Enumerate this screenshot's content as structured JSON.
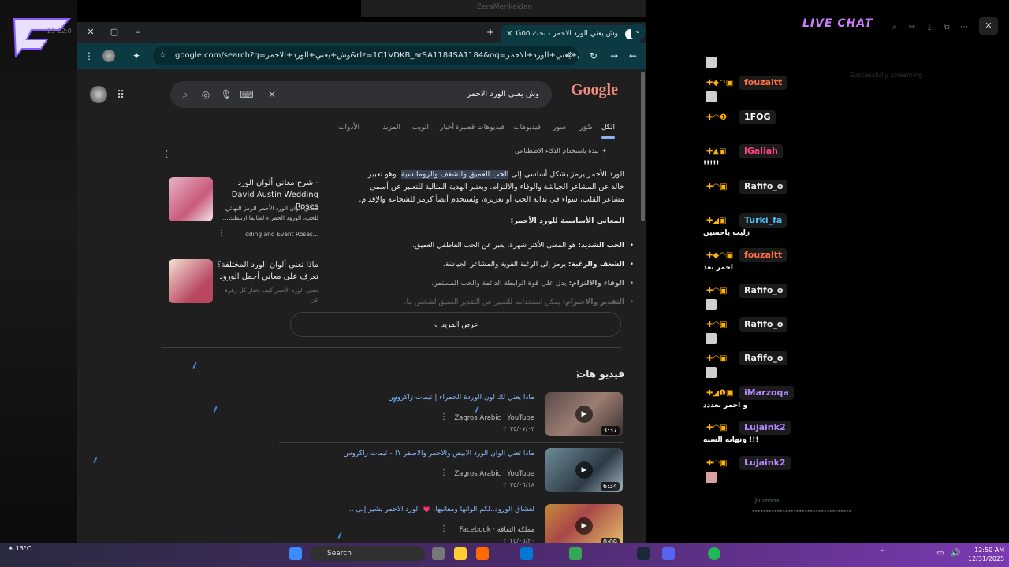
{
  "background": {
    "window_title": "ZeraMerikaidan",
    "clock_ghost": "25 22:0"
  },
  "browser": {
    "tab_title": "وش يعني الورد الاحمر - بحث Goo",
    "url": "google.com/search?q=وش+يعني+الورد+الاحمر&rlz=1C1VDKB_arSA1184SA1184&oq=وش+يعني+الورد+الاحمر&gs_lcrp...",
    "new_tab": "+",
    "icons": {
      "star": "star-icon",
      "tune": "tune-icon",
      "extensions": "puzzle-icon",
      "menu": "kebab-icon",
      "reload": "reload-icon",
      "back": "back-icon",
      "forward": "forward-icon"
    }
  },
  "google": {
    "logo": "Google",
    "query": "وش يعني الورد الاحمر",
    "tabs": [
      "الكل",
      "صُوَر",
      "سور",
      "فيديوهات",
      "فيديوهات قصيرة",
      "أخبار",
      "الويب",
      "المزيد",
      "الأدوات"
    ],
    "aio_label": "نبذة باستخدام الذكاء الاصطناعي",
    "aio_text_pre": "الورد الأحمر يرمز بشكل أساسي إلى ",
    "aio_text_hl": "الحب العميق والشغف والرومانسية",
    "aio_text_post": "، وهو تعبير خالد عن المشاعر الجياشة والوفاء والالتزام. ويعتبر الهدية المثالية للتعبير عن أسمى مشاعر القلب، سواء في بداية الحب أو تعزيزه، ويُستخدم أيضاً كرمز للشجاعة والإقدام.",
    "aio_heading": "المعاني الأساسية للورد الأحمر:",
    "bullets": [
      {
        "b": "الحب الشديد:",
        "t": " هو المعنى الأكثر شهرة، يعبر عن الحب العاطفي العميق."
      },
      {
        "b": "الشغف والرغبة:",
        "t": " يرمز إلى الرغبة القوية والمشاعر الجياشة."
      },
      {
        "b": "الوفاء والالتزام:",
        "t": " يدل على قوة الرابطة الدائمة والحب المستمر."
      },
      {
        "b": "التقدير والاحترام:",
        "t": " يمكن استخدامه للتعبير عن التقدير العميق لشخص ما."
      }
    ],
    "cards": [
      {
        "title": "شرح معاني ألوان الورد - David Austin Wedding Roses",
        "sub": "معاني ألوان الورد الأحمر الرمز النهائي للحب، الورود الحمراء لطالما ارتبطت...",
        "src": "dding and Event Roses..."
      },
      {
        "title": "ماذا تعني ألوان الورد المختلفة؟ تعرف على معاني أجمل الورود",
        "sub": "معنى الورد الأحمر كيف تختار كل زهرة عن",
        "src": ""
      }
    ],
    "show_more": "عرض المزيد",
    "videos_heading": "فيديو هات",
    "videos": [
      {
        "title": "ماذا يعني لك لون الوردة الحمراء | ثيمات زاكروس",
        "src": "Zagros Arabic · YouTube",
        "date": "٢٠٢٥/٠٧/٠٣",
        "dur": "3:37"
      },
      {
        "title": "ماذا تعني ألوان الورد الابيض والاحمر والاصفر ؟! - ثيمات زاكروس",
        "src": "Zagros Arabic · YouTube",
        "date": "٢٠٢٥/٠٦/١٨",
        "dur": "6:34"
      },
      {
        "title": "لعشاق الورود..لكم ألوانها ومعانيها. 💗 الورد الأحمر يشير إلى ...",
        "src": "Facebook · مملكة الثقافة",
        "date": "٢٠٢٥/٠٥/٢٠",
        "dur": "0:09"
      }
    ]
  },
  "chat": {
    "title": "LIVE CHAT",
    "ghost": "Successfully streaming",
    "messages": [
      {
        "name": "fouzaltt",
        "color": "#ffb300",
        "text": ""
      },
      {
        "name": "fouzaltt",
        "color": "#ff7043",
        "text": ""
      },
      {
        "name": "1FOG",
        "color": "#ffffff",
        "text": ""
      },
      {
        "name": "lGaliah",
        "color": "#ff4081",
        "text": "!!!!!"
      },
      {
        "name": "Rafifo_o",
        "color": "#e8eaed",
        "text": ""
      },
      {
        "name": "Turki_fa",
        "color": "#4fc3f7",
        "text": "زليت ياحسين"
      },
      {
        "name": "fouzaltt",
        "color": "#ff7043",
        "text": "احمر بعد"
      },
      {
        "name": "Rafifo_o",
        "color": "#e8eaed",
        "text": ""
      },
      {
        "name": "Rafifo_o",
        "color": "#e8eaed",
        "text": ""
      },
      {
        "name": "Rafifo_o",
        "color": "#e8eaed",
        "text": ""
      },
      {
        "name": "iMarzoqa",
        "color": "#b388ff",
        "text": "و احمر بعددد"
      },
      {
        "name": "Lujaink2",
        "color": "#b388ff",
        "text": "!!! ونهايه السنه"
      },
      {
        "name": "Lujaink2",
        "color": "#b388ff",
        "text": ""
      }
    ],
    "footer_name": "Juumana",
    "footer_line": "************************************"
  },
  "taskbar": {
    "temp": "13°C",
    "search": "Search",
    "time": "12:50 AM",
    "date": "12/31/2025"
  }
}
